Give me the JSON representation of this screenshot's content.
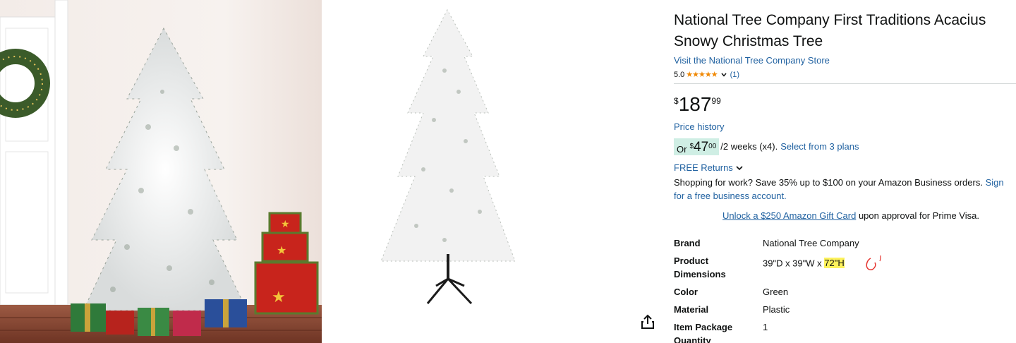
{
  "product": {
    "title": "National Tree Company First Traditions Acacius Snowy Christmas Tree",
    "store_link": "Visit the National Tree Company Store",
    "rating_value": "5.0",
    "stars": "★★★★★",
    "review_count": "(1)"
  },
  "price": {
    "symbol": "$",
    "whole": "187",
    "fraction": "99",
    "history_link": "Price history"
  },
  "installment": {
    "or": "Or",
    "symbol": "$",
    "whole": "47",
    "fraction": "00",
    "terms": "/2 weeks (x4).",
    "plans_link": "Select from 3 plans"
  },
  "returns": {
    "label": "FREE Returns"
  },
  "business": {
    "text": "Shopping for work? Save 35% up to $100 on your Amazon Business orders.",
    "signup_link": "Sign for a free business account."
  },
  "gift": {
    "link": "Unlock a $250 Amazon Gift Card",
    "text": "upon approval for Prime Visa."
  },
  "specs": [
    {
      "label": "Brand",
      "value": "National Tree Company"
    },
    {
      "label": "Product Dimensions",
      "value": "39\"D x 39\"W x ",
      "highlight": "72\"H"
    },
    {
      "label": "Color",
      "value": "Green"
    },
    {
      "label": "Material",
      "value": "Plastic"
    },
    {
      "label": "Item Package Quantity",
      "value": "1"
    }
  ],
  "colors": {
    "link": "#2162a1",
    "star": "#f08804",
    "installment_bg": "#cfeee4",
    "highlight": "#fdf25c",
    "scribble": "#e5322d"
  },
  "icons": [
    "share-icon",
    "chevron-down-icon"
  ]
}
